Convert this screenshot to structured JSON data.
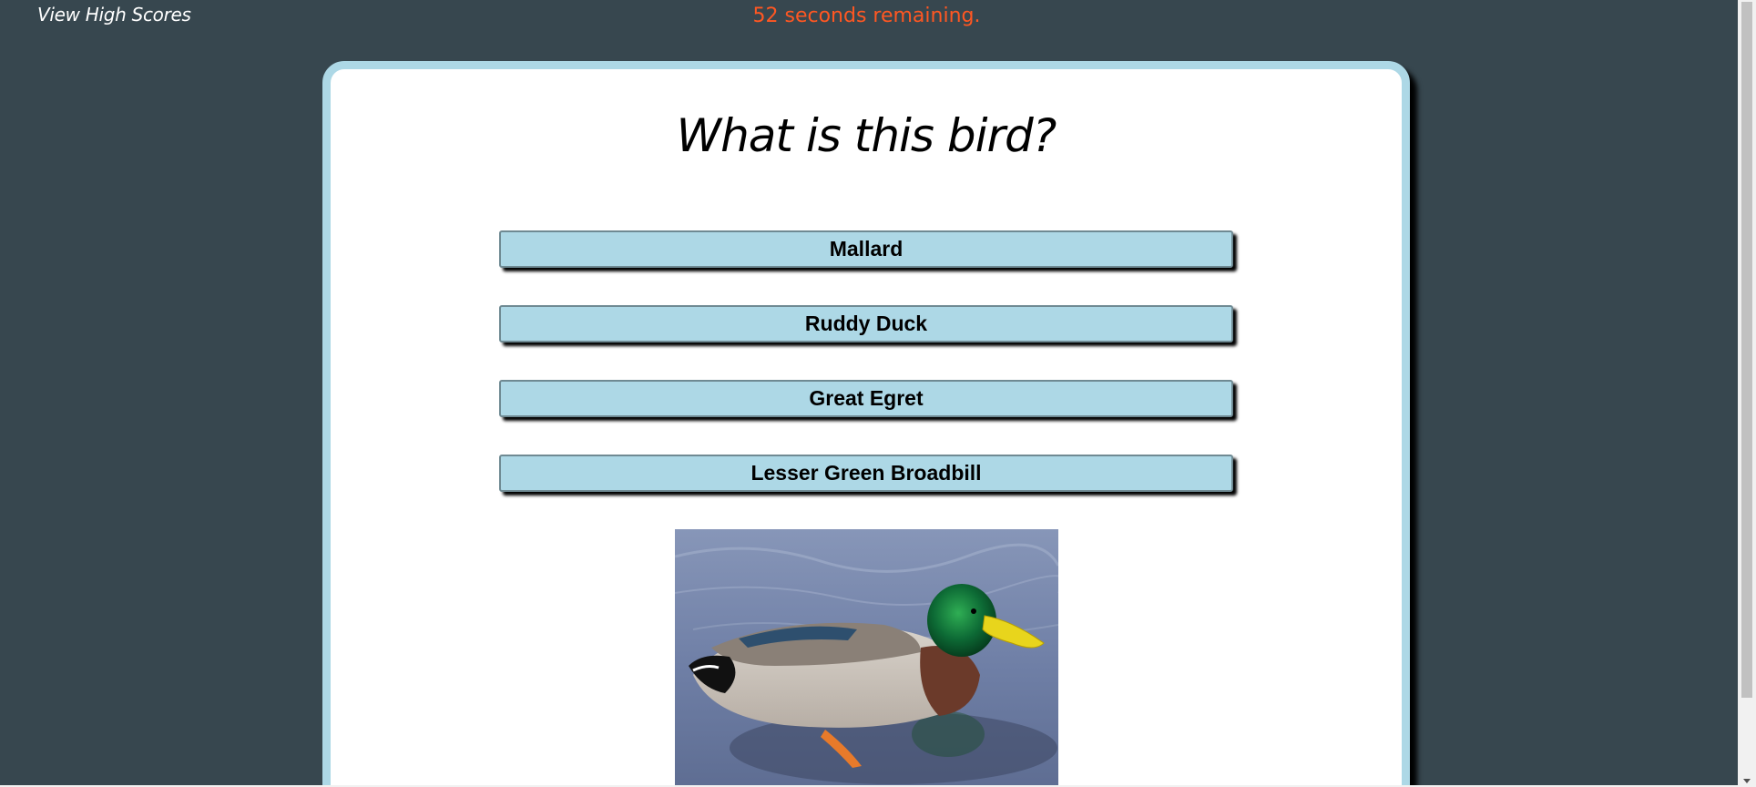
{
  "header": {
    "high_scores_link": "View High Scores",
    "timer_text": "52 seconds remaining."
  },
  "quiz": {
    "question": "What is this bird?",
    "choices": [
      {
        "label": "Mallard"
      },
      {
        "label": "Ruddy Duck"
      },
      {
        "label": "Great Egret"
      },
      {
        "label": "Lesser Green Broadbill"
      }
    ]
  },
  "colors": {
    "page_background": "#37474f",
    "card_border": "#add8e6",
    "button_background": "#add8e6",
    "timer_text": "#ff5722"
  },
  "icons": {
    "scroll_down": "chevron-down-icon"
  }
}
